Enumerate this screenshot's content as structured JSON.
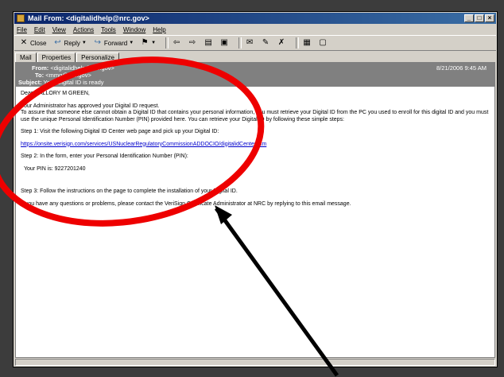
{
  "window": {
    "title": "Mail From: <digitalidhelp@nrc.gov>",
    "controls": [
      "_",
      "□",
      "×"
    ]
  },
  "menu": [
    "File",
    "Edit",
    "View",
    "Actions",
    "Tools",
    "Window",
    "Help"
  ],
  "toolbar": {
    "close": "Close",
    "reply": "Reply",
    "forward": "Forward"
  },
  "tabs": [
    "Mail",
    "Properties",
    "Personalize"
  ],
  "header": {
    "from_label": "From:",
    "from_value": "<digitalidhelp@nrc.gov>",
    "date": "8/21/2006 9:45 AM",
    "to_label": "To:",
    "to_value": "<mmg@nrc.gov>",
    "subject_label": "Subject:",
    "subject_value": "Your Digital ID is ready"
  },
  "body": {
    "greeting": "Dear MALLORY M GREEN,",
    "para1": "Your Administrator has approved your Digital ID request.",
    "para2": "To assure that someone else cannot obtain a Digital ID that contains your personal information, you must retrieve your Digital ID from the PC you used to enroll for this digital ID and you must use the unique Personal Identification Number (PIN) provided here. You can retrieve your Digital ID by following these simple steps:",
    "step1": "Step 1: Visit the following Digital ID Center web page and pick up your Digital ID:",
    "link": "https://onsite.verisign.com/services/USNuclearRegulatoryCommissionADDOCIO/digitalidCenter.htm",
    "step2": "Step 2: In the form, enter your Personal Identification Number (PIN):",
    "pin": "Your PIN is: 9227201240",
    "step3": "Step 3: Follow the instructions on the page to complete the installation of your Digital ID.",
    "closing": "If you have any questions or problems, please contact the VeriSign Certificate Administrator at NRC by replying to this email message."
  },
  "annotation": {
    "color": "#ee0000",
    "arrow_color": "#000000"
  }
}
